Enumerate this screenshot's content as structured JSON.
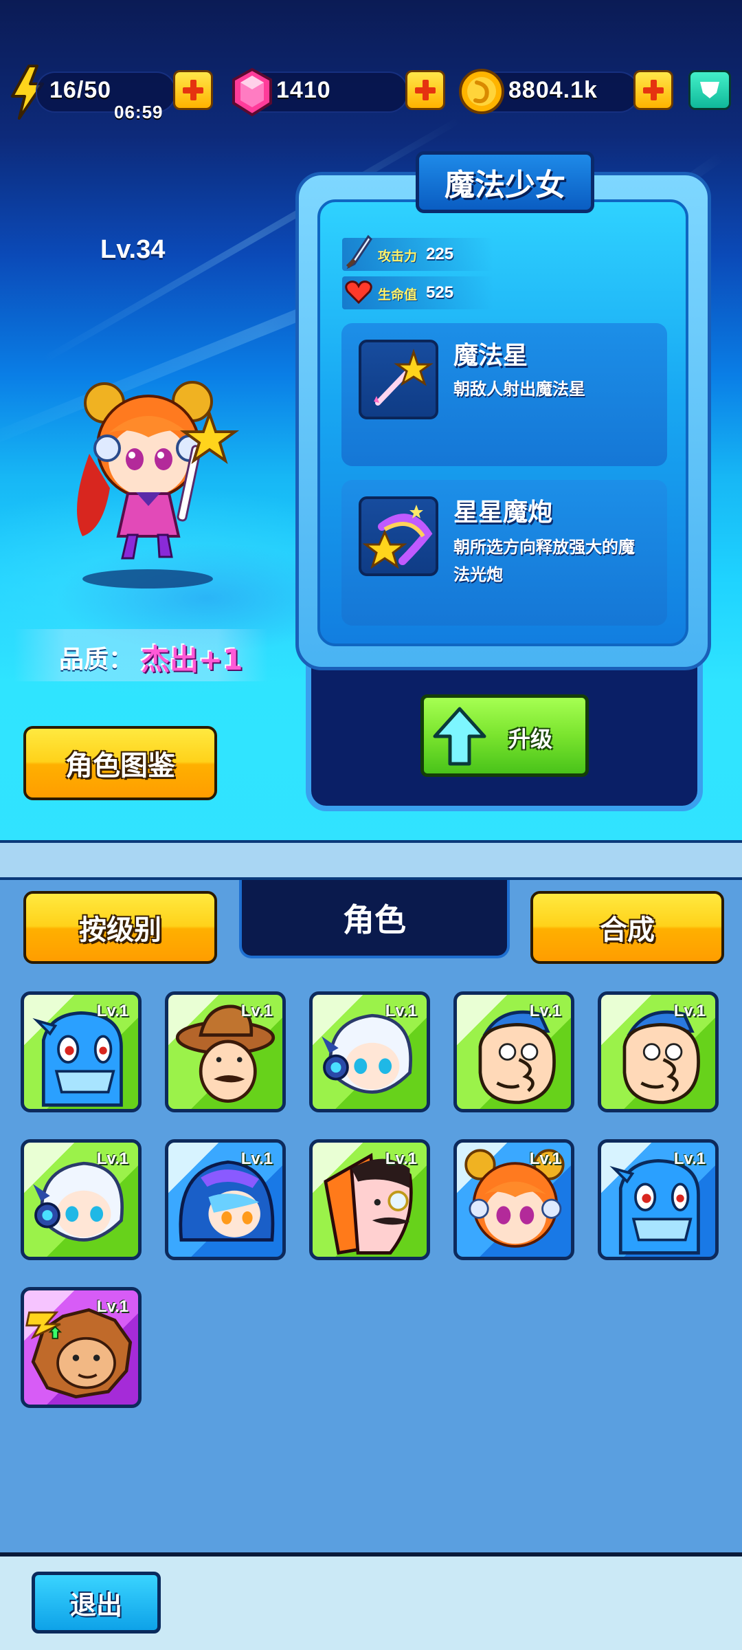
{
  "resources": {
    "energy": "16/50",
    "energy_timer": "06:59",
    "gems": "1410",
    "coins": "8804.1k"
  },
  "hero": {
    "level": "Lv.34",
    "quality_label": "品质：",
    "quality_value": "杰出+1",
    "codex_button": "角色图鉴"
  },
  "panel": {
    "name": "魔法少女",
    "attack_label": "攻击力",
    "attack_value": "225",
    "hp_label": "生命值",
    "hp_value": "525",
    "skills": [
      {
        "name": "魔法星",
        "desc": "朝敌人射出魔法星",
        "icon": "magic-wand-star-icon"
      },
      {
        "name": "星星魔炮",
        "desc_line1": "朝所选方向释放强大的魔",
        "desc_line2": "法光炮",
        "icon": "star-cannon-icon"
      }
    ],
    "upgrade_button": "升级"
  },
  "roster": {
    "sort_button": "按级别",
    "active_tab": "角色",
    "merge_button": "合成",
    "cards": [
      {
        "level": "Lv.1",
        "rarity": "green",
        "portrait": "blue-fish-monster"
      },
      {
        "level": "Lv.1",
        "rarity": "green",
        "portrait": "cowboy"
      },
      {
        "level": "Lv.1",
        "rarity": "green",
        "portrait": "white-haired-headset-hero"
      },
      {
        "level": "Lv.1",
        "rarity": "green",
        "portrait": "cap-man"
      },
      {
        "level": "Lv.1",
        "rarity": "green",
        "portrait": "cap-man"
      },
      {
        "level": "Lv.1",
        "rarity": "green",
        "portrait": "white-haired-headset-hero"
      },
      {
        "level": "Lv.1",
        "rarity": "blue",
        "portrait": "blue-hooded-girl"
      },
      {
        "level": "Lv.1",
        "rarity": "green",
        "portrait": "villain-monocle"
      },
      {
        "level": "Lv.1",
        "rarity": "blue",
        "portrait": "magic-girl"
      },
      {
        "level": "Lv.1",
        "rarity": "blue",
        "portrait": "blue-fish-monster"
      },
      {
        "level": "Lv.1",
        "rarity": "purple",
        "portrait": "lion-monkey"
      }
    ]
  },
  "footer": {
    "exit_button": "退出"
  },
  "colors": {
    "yellow_button": "#ffc400",
    "green_button": "#7ae42e",
    "panel_blue": "#18a7f2",
    "roster_bg": "#5a9fe0"
  }
}
